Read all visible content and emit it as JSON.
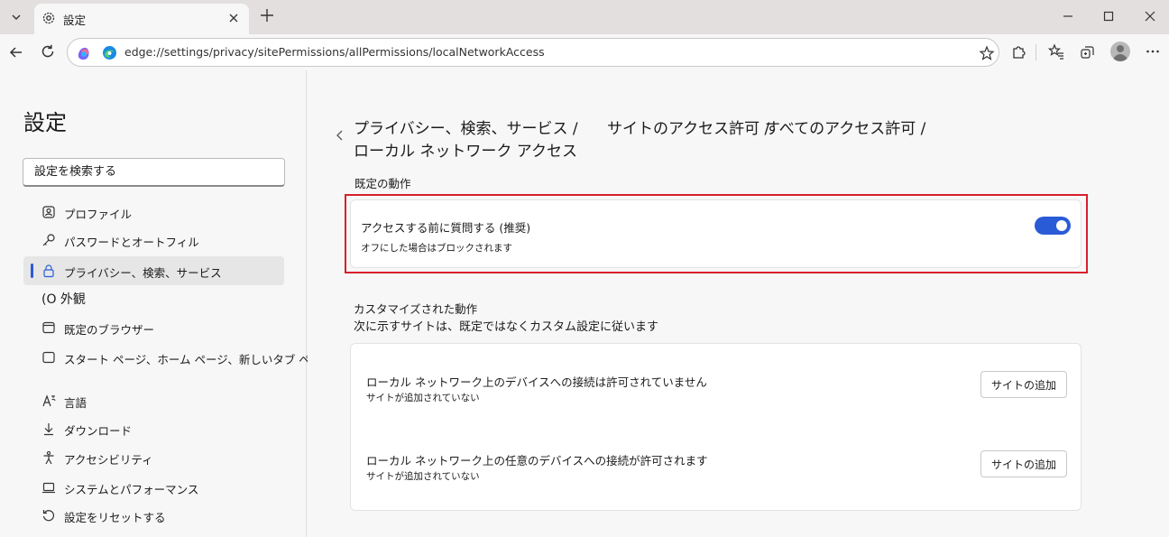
{
  "window": {
    "tab_title": "設定"
  },
  "address_bar": {
    "url": "edge://settings/privacy/sitePermissions/allPermissions/localNetworkAccess"
  },
  "sidebar": {
    "heading": "設定",
    "search_placeholder": "設定を検索する",
    "items": [
      {
        "label": "プロファイル",
        "icon": "profile-icon"
      },
      {
        "label": "パスワードとオートフィル",
        "icon": "key-icon"
      },
      {
        "label": "プライバシー、検索、サービス",
        "icon": "lock-icon",
        "active": true
      },
      {
        "label": "(O 外観",
        "icon": "appearance-icon"
      },
      {
        "label": "既定のブラウザー",
        "icon": "browser-icon"
      },
      {
        "label": "スタート ページ、ホーム ページ、新しいタブ ページ",
        "icon": "home-icon"
      },
      {
        "label": "言語",
        "icon": "language-icon"
      },
      {
        "label": "ダウンロード",
        "icon": "download-icon"
      },
      {
        "label": "アクセシビリティ",
        "icon": "accessibility-icon"
      },
      {
        "label": "システムとパフォーマンス",
        "icon": "laptop-icon"
      },
      {
        "label": "設定をリセットする",
        "icon": "reset-icon"
      }
    ]
  },
  "breadcrumb": {
    "part1": "プライバシー、検索、サービス /",
    "part2": "サイトのアクセス許可 /",
    "part3": "すべてのアクセス許可 /",
    "current": "ローカル ネットワーク アクセス"
  },
  "default_behavior": {
    "label": "既定の動作",
    "setting_title": "アクセスする前に質問する (推奨)",
    "setting_sub": "オフにした場合はブロックされます",
    "toggle_on": true
  },
  "custom_behavior": {
    "label": "カスタマイズされた動作",
    "description": "次に示すサイトは、既定ではなくカスタム設定に従います",
    "rows": [
      {
        "title": "ローカル ネットワーク上のデバイスへの接続は許可されていません",
        "sub": "サイトが追加されていない",
        "button": "サイトの追加"
      },
      {
        "title": "ローカル ネットワーク上の任意のデバイスへの接続が許可されます",
        "sub": "サイトが追加されていない",
        "button": "サイトの追加"
      }
    ]
  },
  "colors": {
    "accent": "#2a5bd7",
    "highlight_border": "#d6202c"
  }
}
